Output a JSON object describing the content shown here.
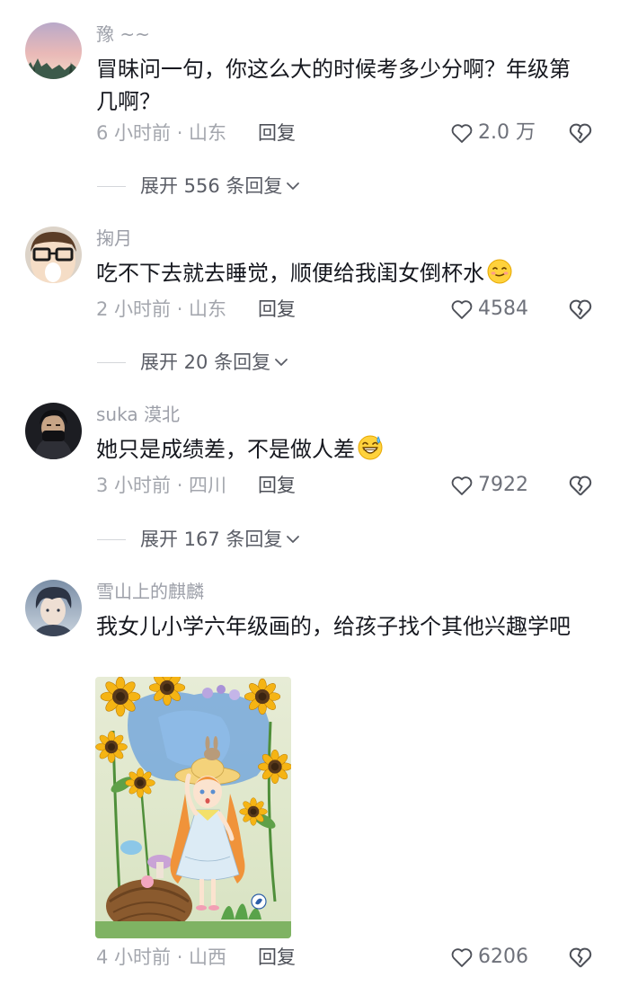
{
  "comments": [
    {
      "username": "豫 ~~",
      "text": "冒昧问一句，你这么大的时候考多少分啊？年级第几啊？",
      "meta": "6 小时前 · 山东",
      "reply_label": "回复",
      "likes": "2.0 万",
      "expand": "展开 556 条回复"
    },
    {
      "username": "掬月",
      "text": "吃不下去就去睡觉，顺便给我闺女倒杯水",
      "emoji": "smirk-emoji",
      "meta": "2 小时前 · 山东",
      "reply_label": "回复",
      "likes": "4584",
      "expand": "展开 20 条回复"
    },
    {
      "username": "suka 漠北",
      "text": "她只是成绩差，不是做人差",
      "emoji": "grin-sweat-emoji",
      "meta": "3 小时前 · 四川",
      "reply_label": "回复",
      "likes": "7922",
      "expand": "展开 167 条回复"
    },
    {
      "username": "雪山上的麒麟",
      "text": "我女儿小学六年级画的，给孩子找个其他兴趣学吧",
      "image": "sunflower-girl-drawing",
      "meta": "4 小时前 · 山西",
      "reply_label": "回复",
      "likes": "6206"
    }
  ],
  "icons": {
    "like": "heart-outline-icon",
    "dislike": "broken-heart-icon",
    "expand": "chevron-down-icon"
  }
}
